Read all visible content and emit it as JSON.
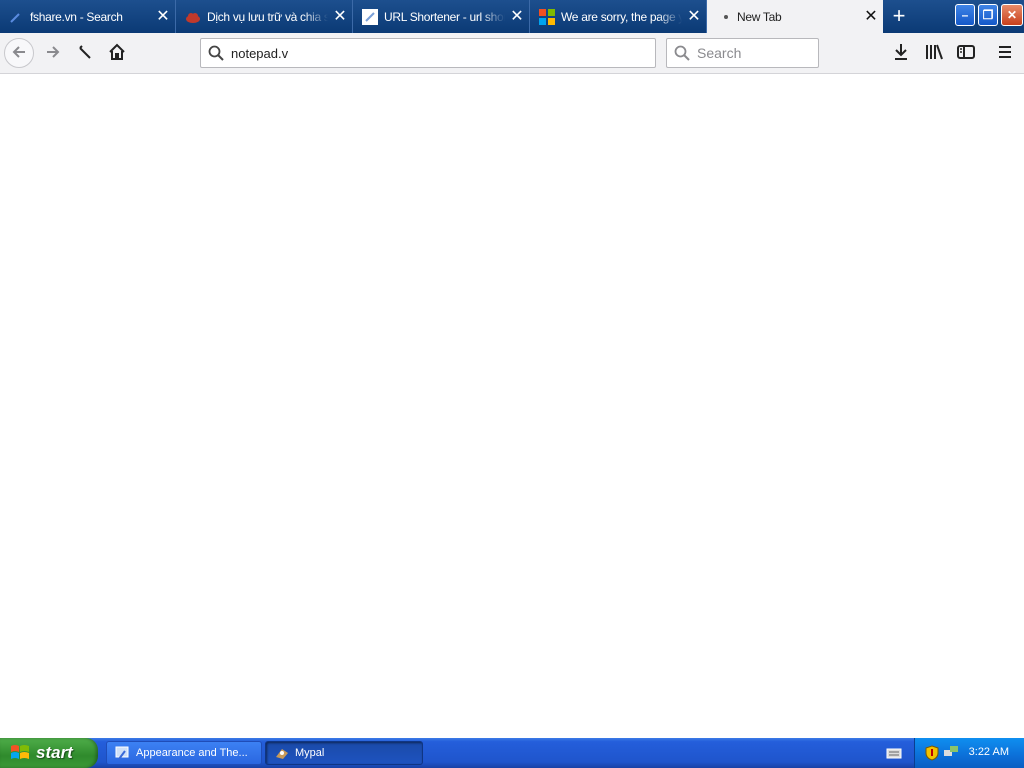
{
  "browser": {
    "tabs": [
      {
        "title": "fshare.vn - Search",
        "icon": "search-favicon",
        "active": false
      },
      {
        "title": "Dịch vụ lưu trữ và chia sẻ",
        "icon": "cloud-favicon",
        "active": false
      },
      {
        "title": "URL Shortener - url short",
        "icon": "link-favicon",
        "active": false
      },
      {
        "title": "We are sorry, the page y",
        "icon": "microsoft-favicon",
        "active": false
      },
      {
        "title": "New Tab",
        "icon": "dot-favicon",
        "active": true
      }
    ],
    "new_tab_label": "+",
    "window_buttons": {
      "minimize": "–",
      "restore": "❐",
      "close": "✕"
    },
    "url_value": "notepad.v",
    "search_placeholder": "Search",
    "toolbar_icons": [
      "back-icon",
      "forward-icon",
      "stop-icon",
      "home-icon",
      "download-icon",
      "library-icon",
      "sidebar-icon",
      "menu-icon"
    ],
    "accent": "#0b3a75"
  },
  "taskbar": {
    "start_label": "start",
    "items": [
      {
        "label": "Appearance and The...",
        "active": false
      },
      {
        "label": "Mypal",
        "active": true
      }
    ],
    "clock": "3:22 AM"
  }
}
